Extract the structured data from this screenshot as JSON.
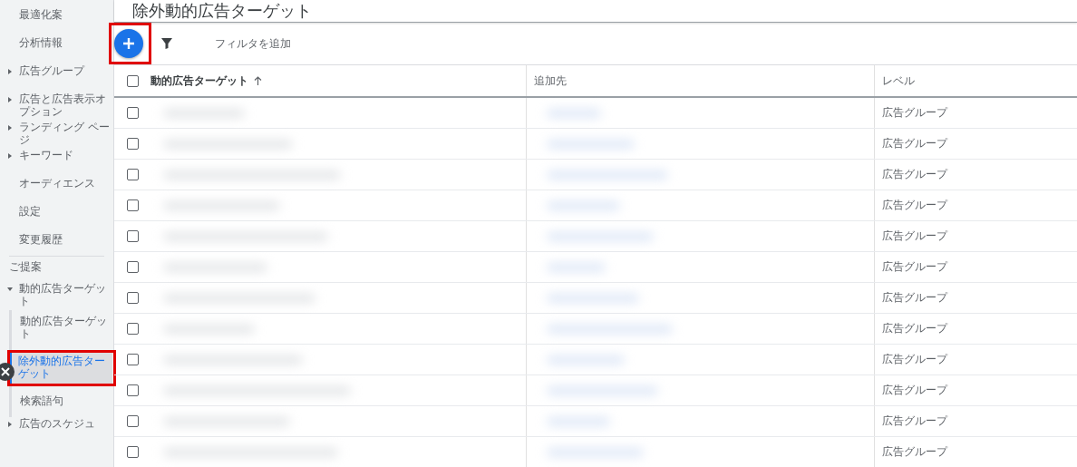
{
  "sidebar": {
    "items": [
      {
        "label": "最適化案",
        "kind": "plain"
      },
      {
        "label": "分析情報",
        "kind": "plain"
      },
      {
        "label": "広告グループ",
        "kind": "group",
        "expanded": false
      },
      {
        "label": "広告と広告表示オプション",
        "kind": "group",
        "expanded": false
      },
      {
        "label": "ランディング ページ",
        "kind": "group",
        "expanded": false
      },
      {
        "label": "キーワード",
        "kind": "group",
        "expanded": false
      },
      {
        "label": "オーディエンス",
        "kind": "plain"
      },
      {
        "label": "設定",
        "kind": "plain"
      },
      {
        "label": "変更履歴",
        "kind": "plain"
      },
      {
        "label": "ご提案",
        "kind": "section"
      },
      {
        "label": "動的広告ターゲット",
        "kind": "group",
        "expanded": true,
        "children": [
          {
            "label": "動的広告ターゲット",
            "selected": false,
            "highlighted": false
          },
          {
            "label": "除外動的広告ターゲット",
            "selected": true,
            "highlighted": true
          },
          {
            "label": "検索語句",
            "selected": false,
            "highlighted": false
          }
        ]
      },
      {
        "label": "広告のスケジュ",
        "kind": "group",
        "expanded": false
      }
    ]
  },
  "page_title": "除外動的広告ターゲット",
  "toolbar": {
    "add_highlighted": true,
    "filter_label": "フィルタを追加"
  },
  "table": {
    "columns": [
      {
        "label": "動的広告ターゲット",
        "sorted": true
      },
      {
        "label": "追加先",
        "sorted": false
      },
      {
        "label": "レベル",
        "sorted": false
      }
    ],
    "header_checked": false,
    "rows": [
      {
        "checked": false,
        "level": "広告グループ"
      },
      {
        "checked": false,
        "level": "広告グループ"
      },
      {
        "checked": false,
        "level": "広告グループ"
      },
      {
        "checked": false,
        "level": "広告グループ"
      },
      {
        "checked": false,
        "level": "広告グループ"
      },
      {
        "checked": false,
        "level": "広告グループ"
      },
      {
        "checked": false,
        "level": "広告グループ"
      },
      {
        "checked": false,
        "level": "広告グループ"
      },
      {
        "checked": false,
        "level": "広告グループ"
      },
      {
        "checked": false,
        "level": "広告グループ"
      },
      {
        "checked": false,
        "level": "広告グループ"
      },
      {
        "checked": false,
        "level": "広告グループ"
      }
    ]
  }
}
